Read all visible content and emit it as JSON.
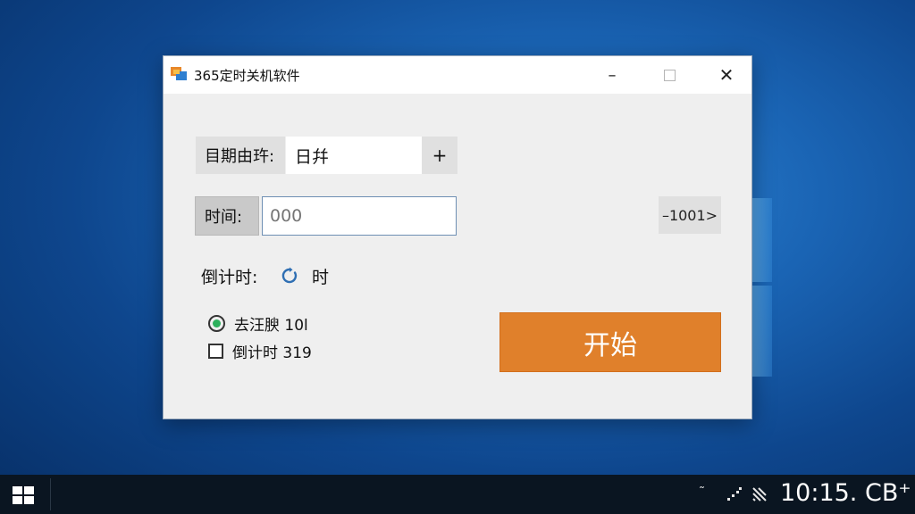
{
  "window": {
    "title": "365定时关机软件",
    "minimize_glyph": "–",
    "close_glyph": "✕",
    "date_row": {
      "label": "目期由玝:",
      "value": "日幷",
      "plus_label": "+"
    },
    "time_row": {
      "label": "时间:",
      "placeholder": "000",
      "side_button_label": "–1001>"
    },
    "countdown_row": {
      "label": "倒计时:",
      "unit": "时"
    },
    "options": [
      {
        "label": "去汪腴 10l",
        "type": "radio",
        "selected": true
      },
      {
        "label": "倒计时 319",
        "type": "checkbox",
        "checked": false
      }
    ],
    "start_button_label": "开始"
  },
  "taskbar": {
    "tray_chevron": "˜",
    "clock": "10:15. CB⁺"
  },
  "icons": {
    "app": "app-icon",
    "refresh": "refresh-icon",
    "start": "windows-start-icon",
    "network": "network-icon",
    "volume": "volume-icon"
  },
  "colors": {
    "accent": "#e0802b",
    "radio_selected": "#2db05c",
    "taskbar": "#0a1521",
    "refresh_icon": "#2f6fb3"
  }
}
